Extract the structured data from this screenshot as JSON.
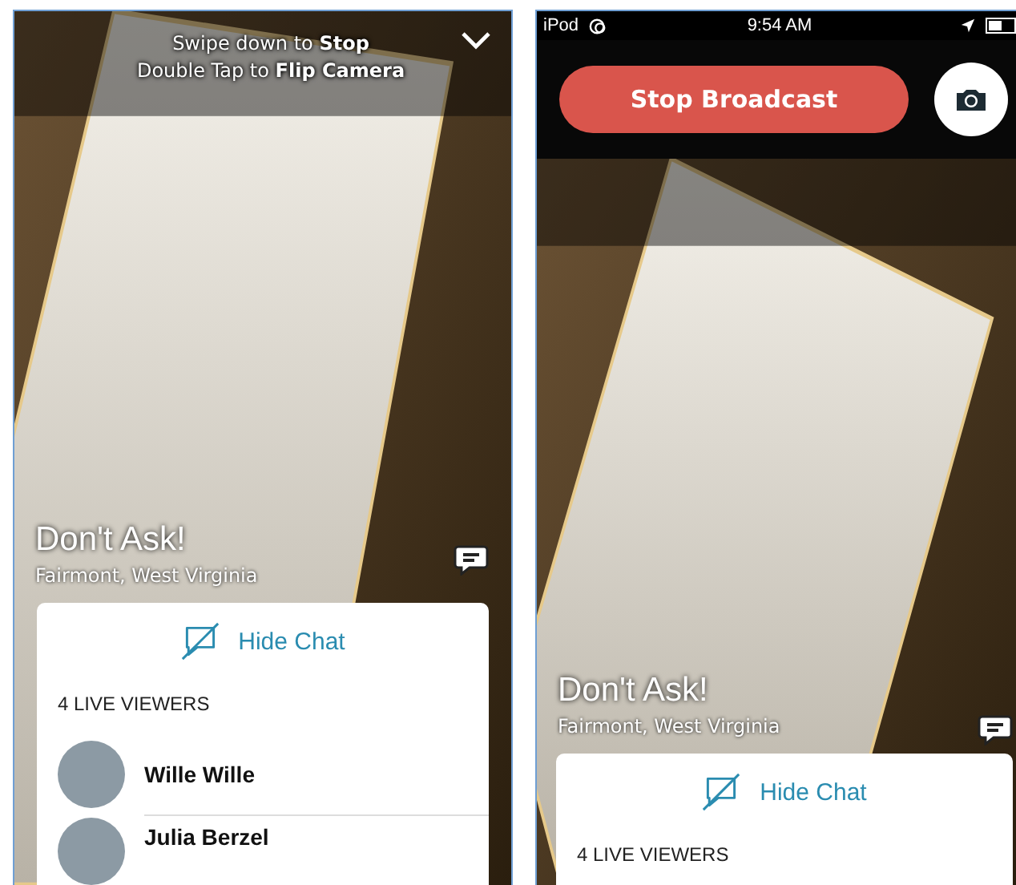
{
  "left_screen": {
    "hints": [
      "Swipe down to **Stop**",
      "Double Tap to **Flip Camera**"
    ],
    "broadcast_title": "Don't Ask!",
    "location": "Fairmont, West Virginia",
    "chat_toggle": "Hide Chat",
    "viewers_heading": "4 LIVE VIEWERS",
    "viewers": [
      {
        "name": "Wille Wille"
      },
      {
        "name": "Julia Berzel"
      }
    ]
  },
  "right_screen": {
    "status_bar": {
      "carrier": "iPod",
      "time": "9:54 AM"
    },
    "stop_button": "Stop Broadcast",
    "broadcast_title": "Don't Ask!",
    "location": "Fairmont, West Virginia",
    "chat_toggle": "Hide Chat",
    "viewers_heading": "4 LIVE VIEWERS"
  }
}
